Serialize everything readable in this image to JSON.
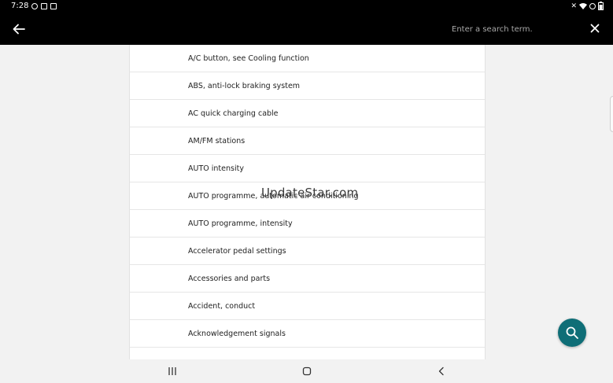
{
  "status_bar": {
    "time": "7:28",
    "left_icons": [
      "dnd-icon",
      "gallery-icon",
      "notification-icon"
    ],
    "right_icons": [
      "mute-icon",
      "wifi-icon",
      "block-icon",
      "battery-icon"
    ]
  },
  "app_bar": {
    "back_icon": "arrow-left-icon",
    "search_placeholder": "Enter a search term.",
    "close_icon": "close-icon"
  },
  "list": {
    "items": [
      {
        "label": "A/C button, see Cooling function"
      },
      {
        "label": "ABS, anti-lock braking system"
      },
      {
        "label": "AC quick charging cable"
      },
      {
        "label": "AM/FM stations"
      },
      {
        "label": "AUTO intensity"
      },
      {
        "label": "AUTO programme, automatic air conditioning"
      },
      {
        "label": "AUTO programme, intensity"
      },
      {
        "label": "Accelerator pedal settings"
      },
      {
        "label": "Accessories and parts"
      },
      {
        "label": "Accident, conduct"
      },
      {
        "label": "Acknowledgement signals"
      }
    ]
  },
  "watermark": "UpdateStar.com",
  "fab": {
    "icon": "search-icon",
    "color": "#0f6e77"
  },
  "nav_bar": {
    "icons": [
      "recents-icon",
      "home-icon",
      "back-icon"
    ]
  }
}
